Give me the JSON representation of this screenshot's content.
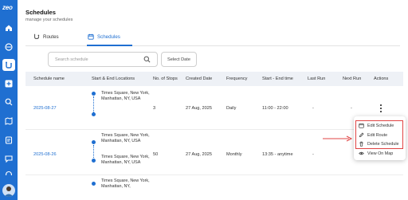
{
  "sidebar": {
    "logo": "zeo",
    "icons": [
      "home-icon",
      "dashboard-icon",
      "routes-icon",
      "add-icon",
      "search-icon",
      "map-icon",
      "document-icon",
      "chat-icon",
      "headset-icon"
    ],
    "active": "routes-icon",
    "accent": "#1f6fd1"
  },
  "page": {
    "title": "Schedules",
    "subtitle": "manage your schedules"
  },
  "tabs": [
    {
      "label": "Routes",
      "icon": "routes-icon"
    },
    {
      "label": "Schedules",
      "icon": "calendar-icon"
    }
  ],
  "filters": {
    "search_placeholder": "Search schedule",
    "select_date": "Select Date"
  },
  "table": {
    "columns": [
      "Schedule name",
      "Start & End Locations",
      "No. of Stops",
      "Created Date",
      "Frequency",
      "Start - End time",
      "Last Run",
      "Next Run",
      "Actions"
    ],
    "rows": [
      {
        "name": "2025-08-27",
        "start_location": "Times Square, New York, Manhattan, NY, USA",
        "end_location": "",
        "stops": "3",
        "created": "27 Aug, 2025",
        "frequency": "Daily",
        "time": "11:00 - 22:00",
        "last_run": "-",
        "next_run": "-"
      },
      {
        "name": "2025-08-26",
        "start_location": "Times Square, New York, Manhattan, NY, USA",
        "end_location": "Times Square, New York, Manhattan, NY, USA",
        "stops": "50",
        "created": "27 Aug, 2025",
        "frequency": "Monthly",
        "time": "13:35 - anytime",
        "last_run": "-",
        "next_run": ""
      },
      {
        "name": "",
        "start_location": "Times Square, New York, Manhattan, NY,",
        "end_location": "",
        "stops": "",
        "created": "",
        "frequency": "",
        "time": "",
        "last_run": "",
        "next_run": ""
      }
    ]
  },
  "actions_menu": {
    "items": [
      {
        "label": "Edit Schedule",
        "icon": "calendar-edit-icon"
      },
      {
        "label": "Edit Route",
        "icon": "pencil-icon"
      },
      {
        "label": "Delete Schedule",
        "icon": "trash-icon"
      },
      {
        "label": "View On Map",
        "icon": "eye-icon"
      }
    ],
    "highlight_color": "#e04444"
  }
}
